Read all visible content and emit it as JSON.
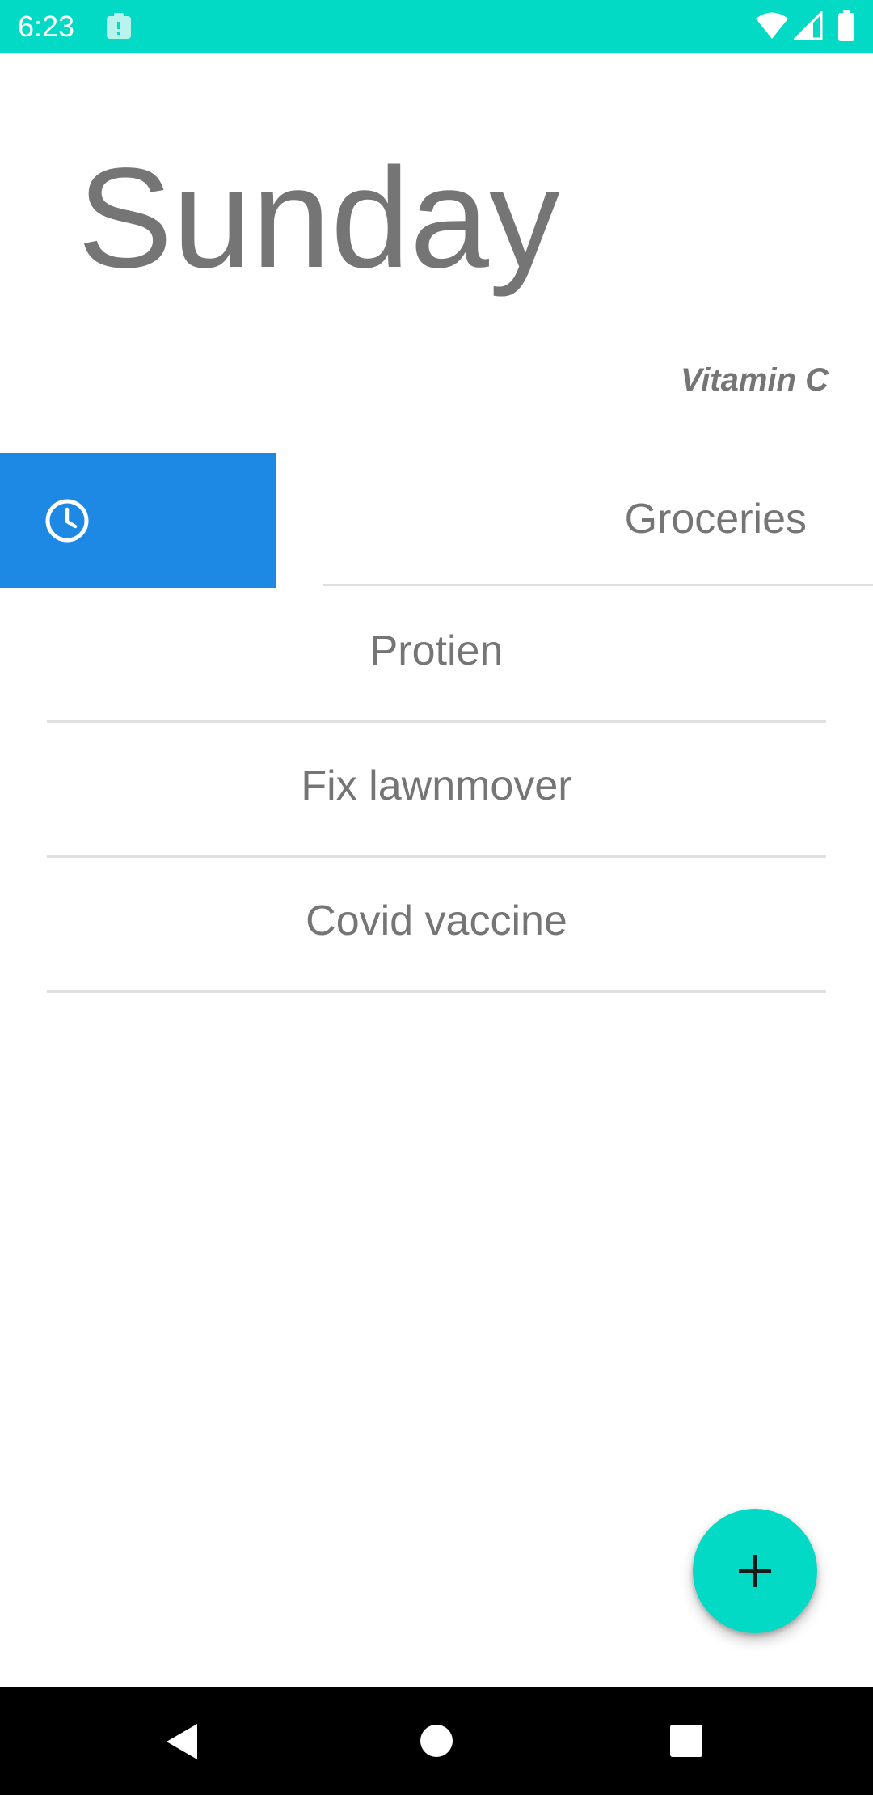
{
  "status_bar": {
    "time": "6:23",
    "background_color": "#03DAC5",
    "icons": [
      "notification-icon",
      "wifi-icon",
      "signal-icon",
      "battery-icon"
    ]
  },
  "header": {
    "day": "Sunday",
    "subtitle": "Vitamin C"
  },
  "swiped_item": {
    "label": "Groceries",
    "action_icon": "clock-icon",
    "action_color": "#1E88E5"
  },
  "tasks": [
    {
      "label": "Protien"
    },
    {
      "label": "Fix lawnmover"
    },
    {
      "label": "Covid vaccine"
    }
  ],
  "fab": {
    "icon": "plus-icon",
    "color": "#03DAC5"
  },
  "nav_bar": {
    "icons": [
      "back-icon",
      "home-icon",
      "recents-icon"
    ]
  }
}
